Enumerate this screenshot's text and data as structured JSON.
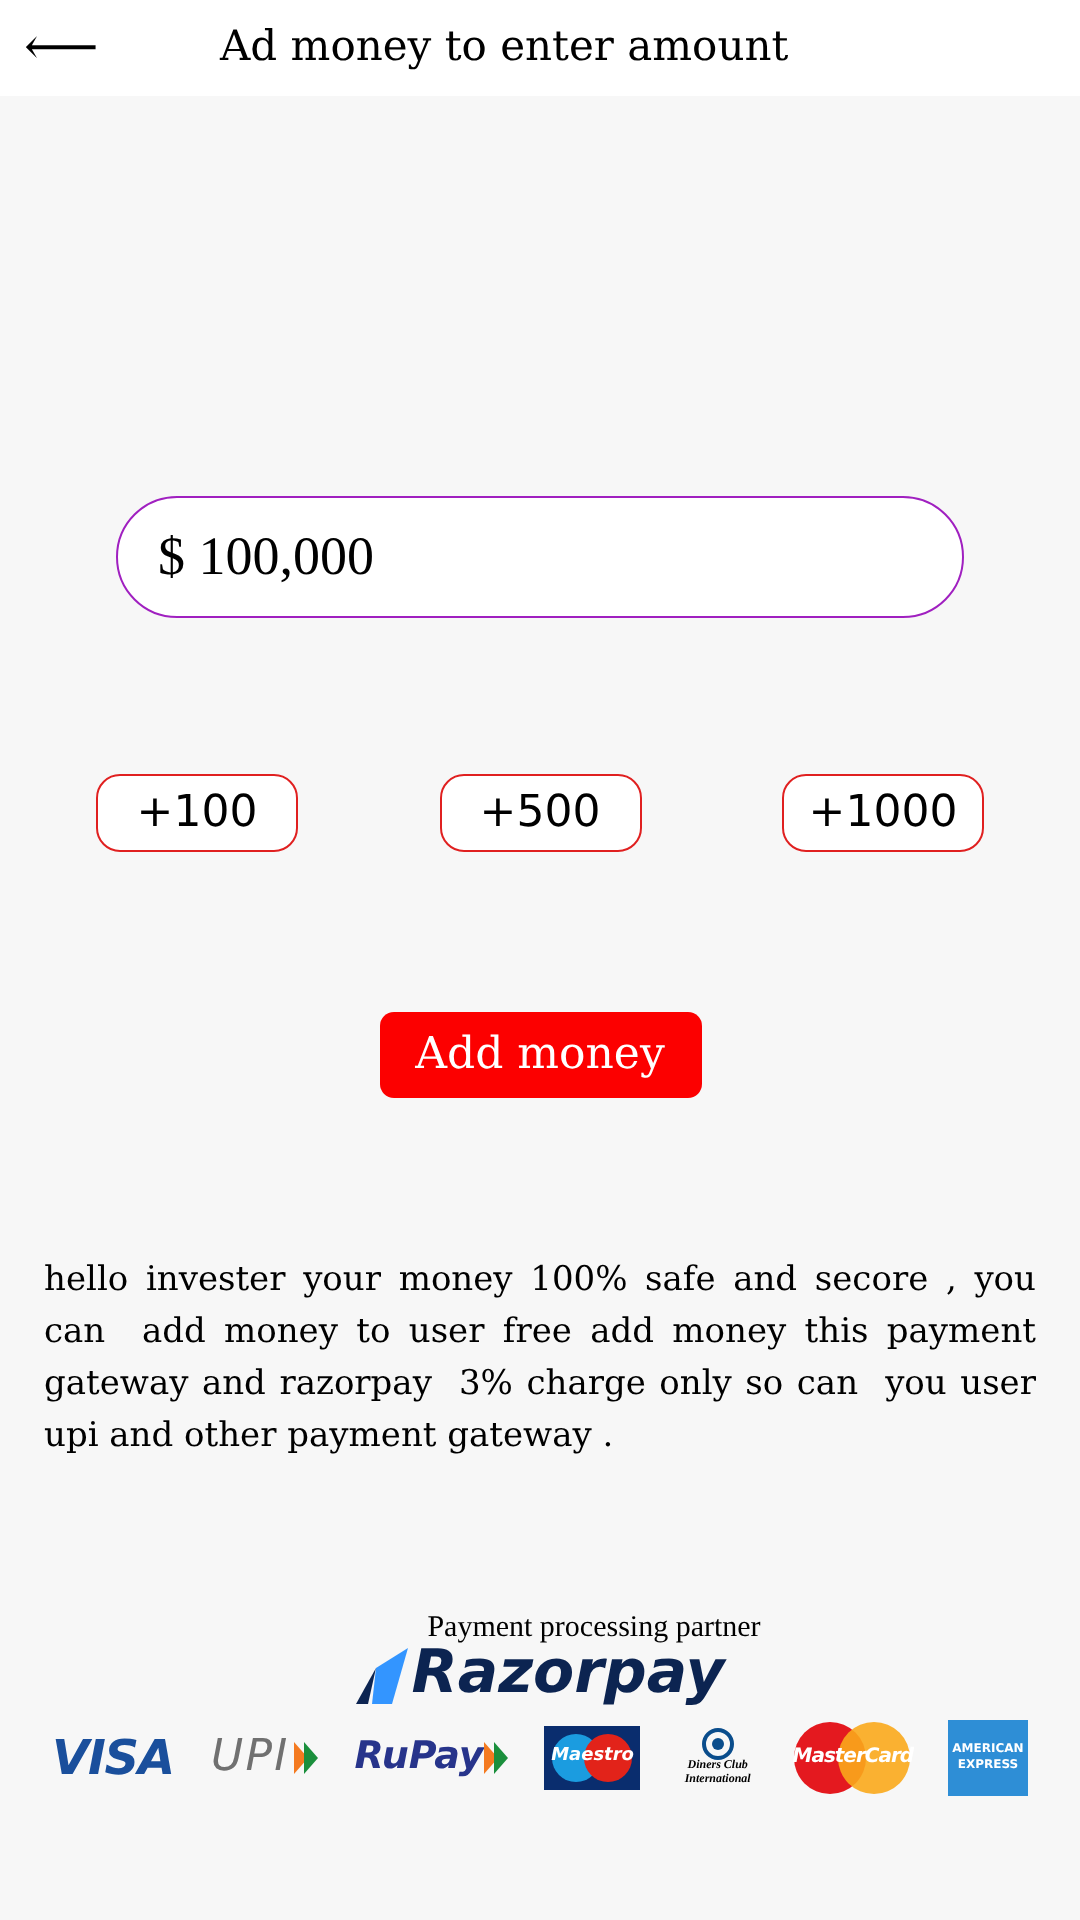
{
  "header": {
    "back": "⟵",
    "title": "Ad money to enter amount"
  },
  "amount_field": {
    "value": "$ 100,000"
  },
  "quick_amounts": [
    {
      "label": "+100"
    },
    {
      "label": "+500"
    },
    {
      "label": "+1000"
    }
  ],
  "add_button": "Add money",
  "notice": "hello invester your money 100% safe and secore , you can  add money to user free add money this payment gateway and razorpay  3% charge only so can  you user upi and other payment gateway .",
  "partner": {
    "caption": "Payment processing partner",
    "logo": "Razorpay"
  },
  "payment_logos": [
    {
      "kind": "visa",
      "text": "VISA"
    },
    {
      "kind": "upi",
      "text": "UPI"
    },
    {
      "kind": "rupay",
      "text": "RuPay"
    },
    {
      "kind": "maestro",
      "text": "Maestro"
    },
    {
      "kind": "diners",
      "text": "Diners Club International"
    },
    {
      "kind": "mastercard",
      "text": "MasterCard"
    },
    {
      "kind": "amex",
      "text": "AMERICAN EXPRESS"
    }
  ]
}
